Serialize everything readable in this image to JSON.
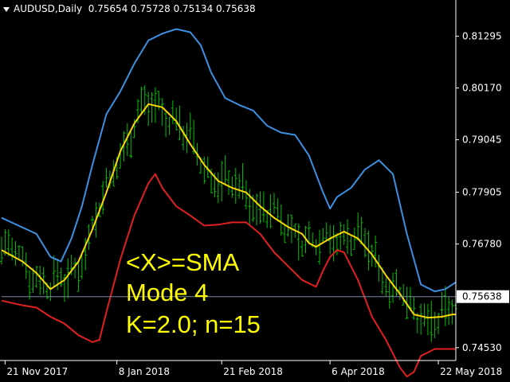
{
  "header": {
    "symbol": "AUDUSD,Daily",
    "ohlc": "0.75654 0.75728 0.75134 0.75638"
  },
  "annotations": [
    "<X>=SMA",
    "Mode 4",
    "K=2.0; n=15"
  ],
  "colors": {
    "background": "#000000",
    "bars": "#00c000",
    "upper_band": "#3d8fe0",
    "middle_band": "#ffd700",
    "lower_band": "#e02020",
    "axis": "#ffffff",
    "price_line": "#7a8aa0"
  },
  "chart_data": {
    "type": "line",
    "title": "AUDUSD,Daily",
    "x_range": [
      0,
      130
    ],
    "ylim": [
      0.7425,
      0.817
    ],
    "x_ticks": [
      {
        "x": 1,
        "label": "21 Nov 2017"
      },
      {
        "x": 33,
        "label": "8 Jan 2018"
      },
      {
        "x": 63,
        "label": "21 Feb 2018"
      },
      {
        "x": 94,
        "label": "6 Apr 2018"
      },
      {
        "x": 125,
        "label": "22 May 2018"
      }
    ],
    "y_ticks": [
      0.81295,
      0.8017,
      0.79045,
      0.77905,
      0.7678,
      0.7453
    ],
    "last_price": 0.75638,
    "last_price_label": "0.75638",
    "grid": false,
    "series": [
      {
        "role": "upper",
        "x": [
          0,
          10,
          14,
          17,
          20,
          23,
          26,
          30,
          34,
          38,
          42,
          46,
          50,
          54,
          57,
          60,
          64,
          68,
          72,
          76,
          80,
          84,
          88,
          92,
          94,
          96,
          100,
          104,
          108,
          112,
          116,
          120,
          124,
          127,
          130
        ],
        "y": [
          0.7735,
          0.77,
          0.765,
          0.764,
          0.769,
          0.776,
          0.785,
          0.796,
          0.801,
          0.807,
          0.812,
          0.8135,
          0.8145,
          0.8138,
          0.811,
          0.805,
          0.7995,
          0.798,
          0.7968,
          0.7935,
          0.792,
          0.7915,
          0.787,
          0.779,
          0.7755,
          0.778,
          0.78,
          0.784,
          0.786,
          0.783,
          0.77,
          0.759,
          0.7575,
          0.758,
          0.7595
        ]
      },
      {
        "role": "middle",
        "x": [
          0,
          6,
          10,
          14,
          18,
          22,
          26,
          30,
          34,
          38,
          42,
          46,
          50,
          54,
          58,
          62,
          66,
          70,
          74,
          78,
          82,
          86,
          88,
          90,
          94,
          98,
          102,
          106,
          110,
          114,
          118,
          122,
          126,
          129,
          130
        ],
        "y": [
          0.7665,
          0.764,
          0.7615,
          0.758,
          0.76,
          0.764,
          0.771,
          0.779,
          0.788,
          0.794,
          0.7982,
          0.7975,
          0.7945,
          0.7895,
          0.785,
          0.7815,
          0.78,
          0.779,
          0.776,
          0.7735,
          0.7715,
          0.77,
          0.768,
          0.7672,
          0.769,
          0.7705,
          0.769,
          0.7655,
          0.761,
          0.757,
          0.7525,
          0.7518,
          0.752,
          0.7525,
          0.7525
        ]
      },
      {
        "role": "lower",
        "x": [
          0,
          6,
          10,
          14,
          18,
          22,
          26,
          28,
          30,
          34,
          38,
          42,
          44,
          46,
          50,
          54,
          58,
          62,
          66,
          70,
          74,
          78,
          82,
          86,
          90,
          92,
          94,
          96,
          98,
          102,
          106,
          110,
          112,
          114,
          116,
          118,
          120,
          124,
          130
        ],
        "y": [
          0.7555,
          0.7545,
          0.754,
          0.752,
          0.7505,
          0.748,
          0.7465,
          0.747,
          0.753,
          0.7645,
          0.774,
          0.781,
          0.783,
          0.78,
          0.776,
          0.774,
          0.7718,
          0.772,
          0.7725,
          0.7725,
          0.77,
          0.766,
          0.763,
          0.76,
          0.7585,
          0.762,
          0.765,
          0.7665,
          0.766,
          0.76,
          0.752,
          0.747,
          0.744,
          0.741,
          0.739,
          0.74,
          0.7435,
          0.745,
          0.745
        ]
      }
    ]
  }
}
